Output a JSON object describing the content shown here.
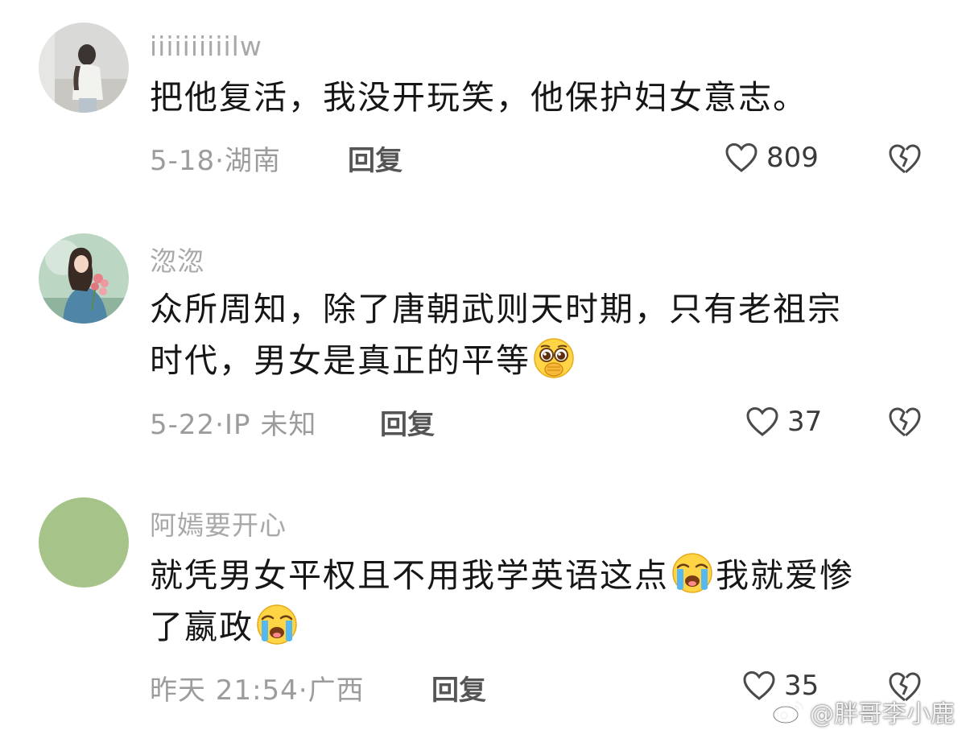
{
  "comments": [
    {
      "username": "iiiiiiiiiilw",
      "text_lines": [
        "把他复活，我没开玩笑，他保护妇女意志。"
      ],
      "date": "5-18",
      "location": "湖南",
      "reply_label": "回复",
      "likes": "809",
      "avatar_icon": "photo-avatar-person"
    },
    {
      "username": "淴淴",
      "text_line1": "众所周知，除了唐朝武则天时期，只有老祖宗",
      "text_line2": "时代，男女是真正的平等",
      "emoji_icon": "pleading-face-emoji",
      "date": "5-22",
      "location": "IP 未知",
      "reply_label": "回复",
      "likes": "37",
      "avatar_icon": "photo-avatar-woman-flowers"
    },
    {
      "username": "阿嫣要开心",
      "text_line1a": "就凭男女平权且不用我学英语这点",
      "text_line1b": "我就爱惨",
      "text_line2": "了嬴政",
      "emoji_icon": "loudly-crying-face-emoji",
      "date": "昨天 21:54",
      "location": "广西",
      "reply_label": "回复",
      "likes": "35",
      "avatar_color": "#a6c48a"
    }
  ],
  "separator": "·",
  "watermark": "@胖哥李小鹿",
  "colors": {
    "username": "#a8a8a8",
    "text": "#161616",
    "meta": "#9c9c9c",
    "avatar_green": "#a6c48a"
  }
}
